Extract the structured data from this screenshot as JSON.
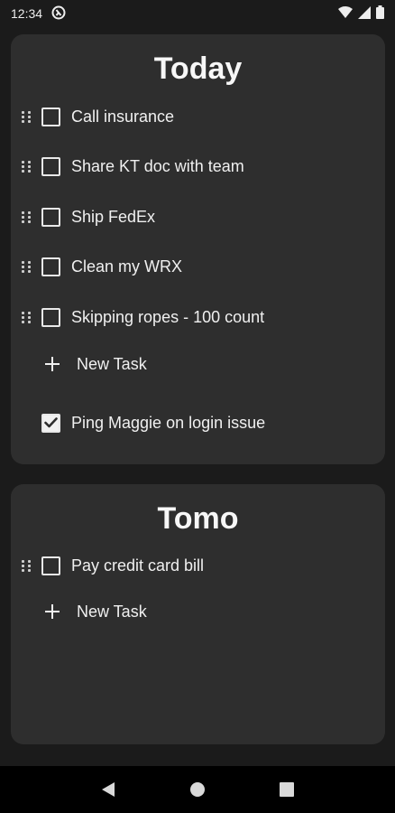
{
  "status_bar": {
    "time": "12:34"
  },
  "today": {
    "title": "Today",
    "tasks": [
      {
        "label": "Call insurance",
        "checked": false
      },
      {
        "label": "Share KT doc with team",
        "checked": false
      },
      {
        "label": "Ship FedEx",
        "checked": false
      },
      {
        "label": "Clean my WRX",
        "checked": false
      },
      {
        "label": "Skipping ropes - 100 count",
        "checked": false
      }
    ],
    "new_task_label": "New Task",
    "completed": [
      {
        "label": "Ping Maggie on login issue",
        "checked": true
      }
    ]
  },
  "tomo": {
    "title": "Tomo",
    "tasks": [
      {
        "label": "Pay credit card bill",
        "checked": false
      }
    ],
    "new_task_label": "New Task"
  },
  "icons": {
    "status_left": [
      "app-notification-icon"
    ],
    "status_right": [
      "wifi-icon",
      "signal-icon",
      "battery-icon"
    ],
    "nav": [
      "back-icon",
      "home-icon",
      "recents-icon"
    ]
  }
}
